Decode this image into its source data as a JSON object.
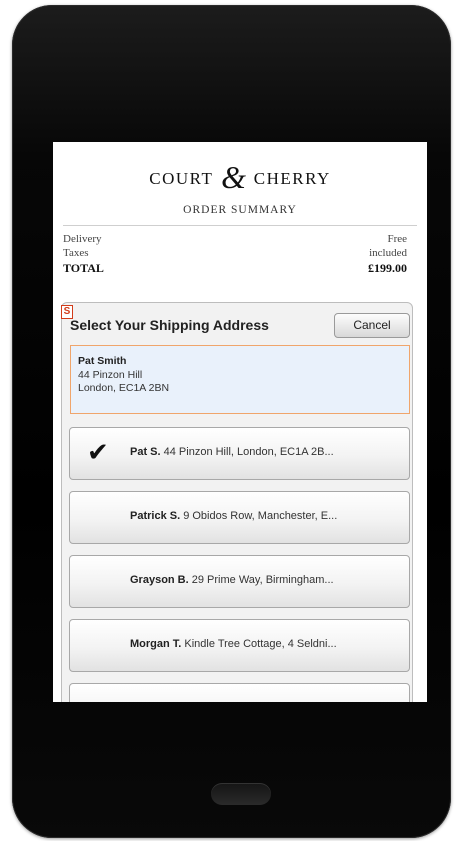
{
  "brand": {
    "left": "COURT",
    "amp": "&",
    "right": "CHERRY"
  },
  "subtitle": "ORDER SUMMARY",
  "summary": {
    "delivery_label": "Delivery",
    "delivery_value": "Free",
    "taxes_label": "Taxes",
    "taxes_value": "included",
    "total_label": "TOTAL",
    "total_value": "£199.00"
  },
  "sheet": {
    "badge": "S",
    "title": "Select Your Shipping Address",
    "cancel_label": "Cancel",
    "selected": {
      "name": "Pat Smith",
      "line1": "44 Pinzon Hill",
      "line2": "London, EC1A 2BN"
    },
    "addresses": [
      {
        "name": "Pat S.",
        "detail": " 44 Pinzon Hill, London, EC1A 2B...",
        "checked": true
      },
      {
        "name": "Patrick S.",
        "detail": " 9 Obidos Row, Manchester, E...",
        "checked": false
      },
      {
        "name": "Grayson B.",
        "detail": " 29 Prime Way, Birmingham...",
        "checked": false
      },
      {
        "name": "Morgan T.",
        "detail": " Kindle Tree Cottage, 4 Seldni...",
        "checked": false
      },
      {
        "name": "",
        "detail": "",
        "checked": false
      }
    ],
    "check_icon": "✔"
  }
}
